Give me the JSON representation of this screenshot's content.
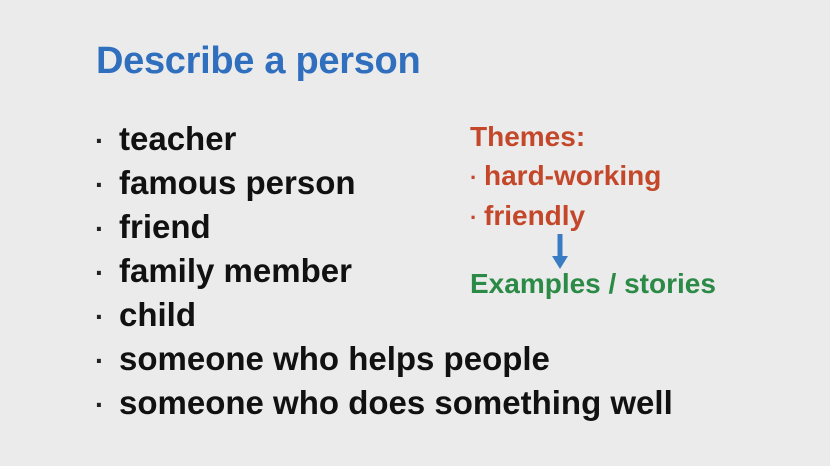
{
  "slide": {
    "title": "Describe a person",
    "bullet_glyph": "·",
    "bullets": [
      "teacher",
      "famous person",
      "friend",
      "family member",
      "child",
      "someone who helps people",
      "someone who does something well"
    ],
    "themes": {
      "heading": "Themes:",
      "items": [
        "hard-working",
        "friendly"
      ]
    },
    "arrow_icon": "arrow-down-icon",
    "examples": "Examples / stories",
    "colors": {
      "background": "#ebebeb",
      "title": "#2f6fbe",
      "themes": "#c4472a",
      "examples": "#2a8a46",
      "arrow": "#3a7cc4"
    }
  }
}
